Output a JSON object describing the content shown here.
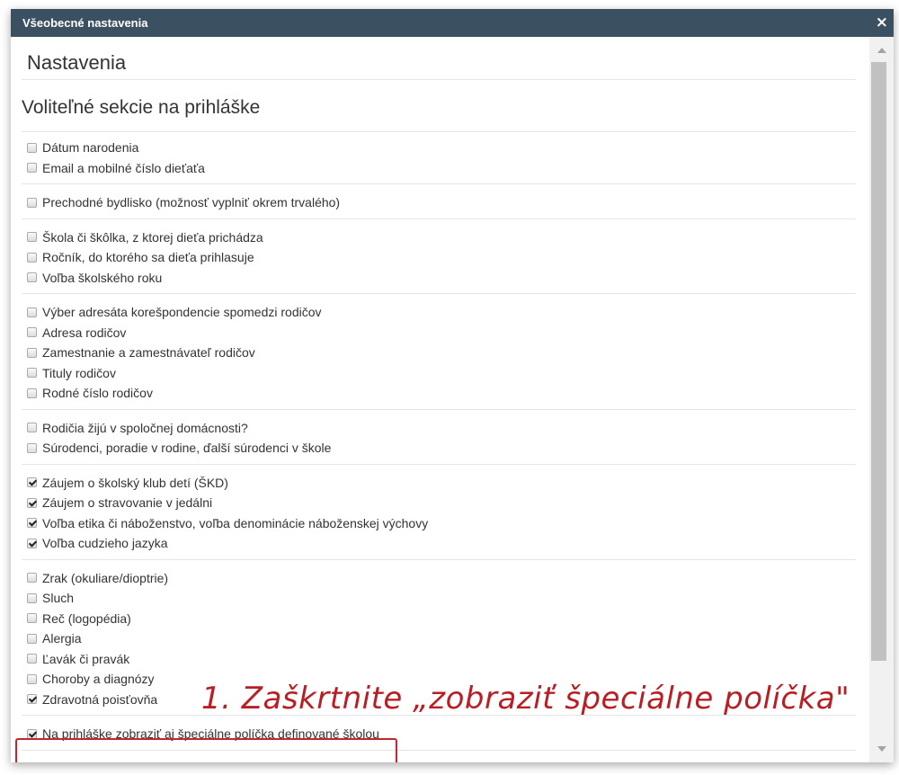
{
  "dialog": {
    "title": "Všeobecné nastavenia",
    "close_icon": "×"
  },
  "page_title": "Nastavenia",
  "section_title": "Voliteľné sekcie na prihláške",
  "groups": [
    {
      "items": [
        {
          "label": "Dátum narodenia",
          "checked": false
        },
        {
          "label": "Email a mobilné číslo dieťaťa",
          "checked": false
        }
      ]
    },
    {
      "items": [
        {
          "label": "Prechodné bydlisko (možnosť vyplniť okrem trvalého)",
          "checked": false
        }
      ]
    },
    {
      "items": [
        {
          "label": "Škola či škôlka, z ktorej dieťa prichádza",
          "checked": false
        },
        {
          "label": "Ročník, do ktorého sa dieťa prihlasuje",
          "checked": false
        },
        {
          "label": "Voľba školského roku",
          "checked": false
        }
      ]
    },
    {
      "items": [
        {
          "label": "Výber adresáta korešpondencie spomedzi rodičov",
          "checked": false
        },
        {
          "label": "Adresa rodičov",
          "checked": false
        },
        {
          "label": "Zamestnanie a zamestnávateľ rodičov",
          "checked": false
        },
        {
          "label": "Tituly rodičov",
          "checked": false
        },
        {
          "label": "Rodné číslo rodičov",
          "checked": false
        }
      ]
    },
    {
      "items": [
        {
          "label": "Rodičia žijú v spoločnej domácnosti?",
          "checked": false
        },
        {
          "label": "Súrodenci, poradie v rodine, ďalší súrodenci v škole",
          "checked": false
        }
      ]
    },
    {
      "items": [
        {
          "label": "Záujem o školský klub detí (ŠKD)",
          "checked": true
        },
        {
          "label": "Záujem o stravovanie v jedálni",
          "checked": true
        },
        {
          "label": "Voľba etika či náboženstvo, voľba denominácie náboženskej výchovy",
          "checked": true
        },
        {
          "label": "Voľba cudzieho jazyka",
          "checked": true
        }
      ]
    },
    {
      "items": [
        {
          "label": "Zrak (okuliare/dioptrie)",
          "checked": false
        },
        {
          "label": "Sluch",
          "checked": false
        },
        {
          "label": "Reč (logopédia)",
          "checked": false
        },
        {
          "label": "Alergia",
          "checked": false
        },
        {
          "label": "Ľavák či pravák",
          "checked": false
        },
        {
          "label": "Choroby a diagnózy",
          "checked": false
        },
        {
          "label": "Zdravotná poisťovňa",
          "checked": true
        }
      ]
    },
    {
      "items": [
        {
          "label": "Na prihláške zobraziť aj špeciálne políčka definované školou",
          "checked": true
        }
      ]
    }
  ],
  "annotation": "1. Zaškrtnite „zobraziť špeciálne políčka\"",
  "colors": {
    "titlebar": "#3b5060",
    "annotation": "#b81f24",
    "highlight_border": "#c0282e"
  }
}
